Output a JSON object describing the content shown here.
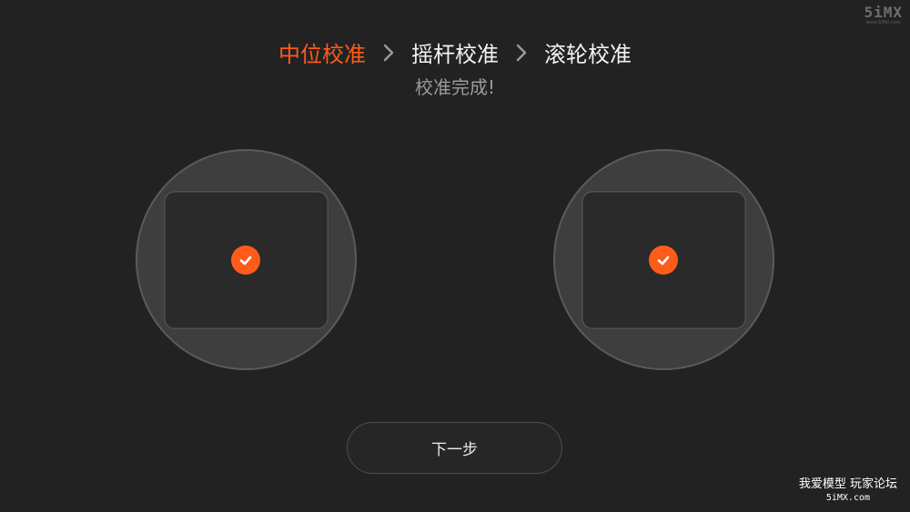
{
  "steps": [
    {
      "label": "中位校准",
      "active": true
    },
    {
      "label": "摇杆校准",
      "active": false
    },
    {
      "label": "滚轮校准",
      "active": false
    }
  ],
  "subtitle": "校准完成!",
  "next_button": "下一步",
  "watermark": {
    "logo": "5iMX",
    "url": "www.5iMX.com",
    "cn_text": "我爱模型 玩家论坛",
    "en_text": "5iMX.com"
  },
  "colors": {
    "background": "#222222",
    "accent": "#ff5b1a",
    "inactive_text": "#f2f2f2",
    "subtitle": "#9a9a9a"
  }
}
